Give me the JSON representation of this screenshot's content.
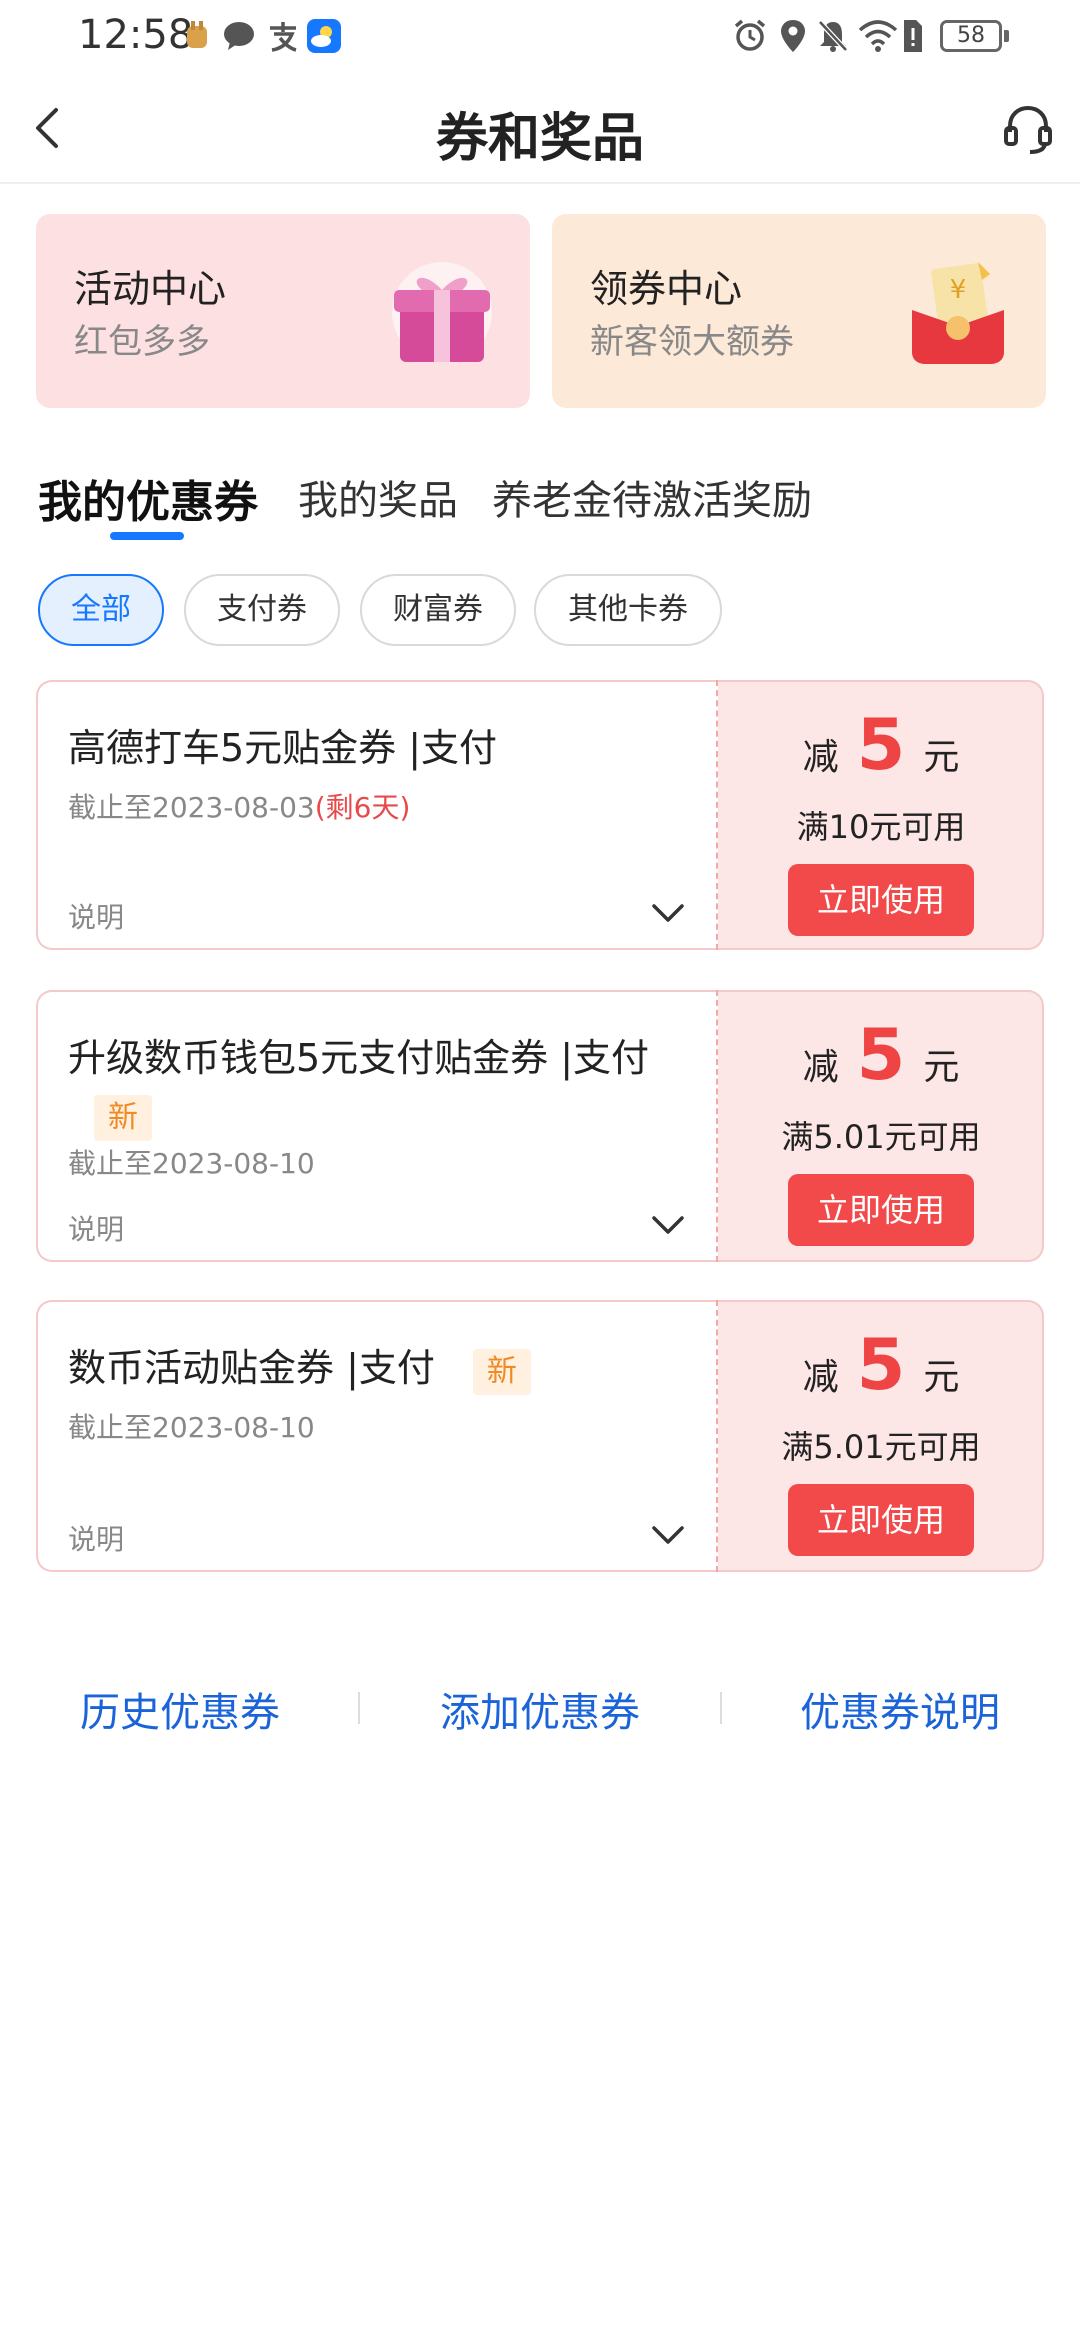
{
  "status_bar": {
    "time": "12:58",
    "battery": "58"
  },
  "header": {
    "title": "券和奖品"
  },
  "entries": [
    {
      "title": "活动中心",
      "subtitle": "红包多多"
    },
    {
      "title": "领券中心",
      "subtitle": "新客领大额券"
    }
  ],
  "tabs": [
    {
      "label": "我的优惠券",
      "active": true
    },
    {
      "label": "我的奖品",
      "active": false
    },
    {
      "label": "养老金待激活奖励",
      "active": false
    }
  ],
  "filters": [
    {
      "label": "全部",
      "active": true
    },
    {
      "label": "支付券",
      "active": false
    },
    {
      "label": "财富券",
      "active": false
    },
    {
      "label": "其他卡券",
      "active": false
    }
  ],
  "coupons": [
    {
      "title": "高德打车5元贴金券 |支付",
      "badge": "",
      "deadline": "截止至2023-08-03",
      "remaining": "(剩6天)",
      "desc_label": "说明",
      "prefix": "减",
      "amount": "5",
      "unit": "元",
      "condition": "满10元可用",
      "button": "立即使用"
    },
    {
      "title": "升级数币钱包5元支付贴金券 |支付",
      "badge": "新",
      "deadline": "截止至2023-08-10",
      "remaining": "",
      "desc_label": "说明",
      "prefix": "减",
      "amount": "5",
      "unit": "元",
      "condition": "满5.01元可用",
      "button": "立即使用"
    },
    {
      "title": "数币活动贴金券 |支付",
      "badge": "新",
      "deadline": "截止至2023-08-10",
      "remaining": "",
      "desc_label": "说明",
      "prefix": "减",
      "amount": "5",
      "unit": "元",
      "condition": "满5.01元可用",
      "button": "立即使用"
    }
  ],
  "footer": {
    "history": "历史优惠券",
    "add": "添加优惠券",
    "explain": "优惠券说明"
  },
  "colors": {
    "brand_blue": "#1677ff",
    "coupon_red": "#f24a4a",
    "amount_red": "#ef4444",
    "link_blue": "#1a63d8"
  }
}
